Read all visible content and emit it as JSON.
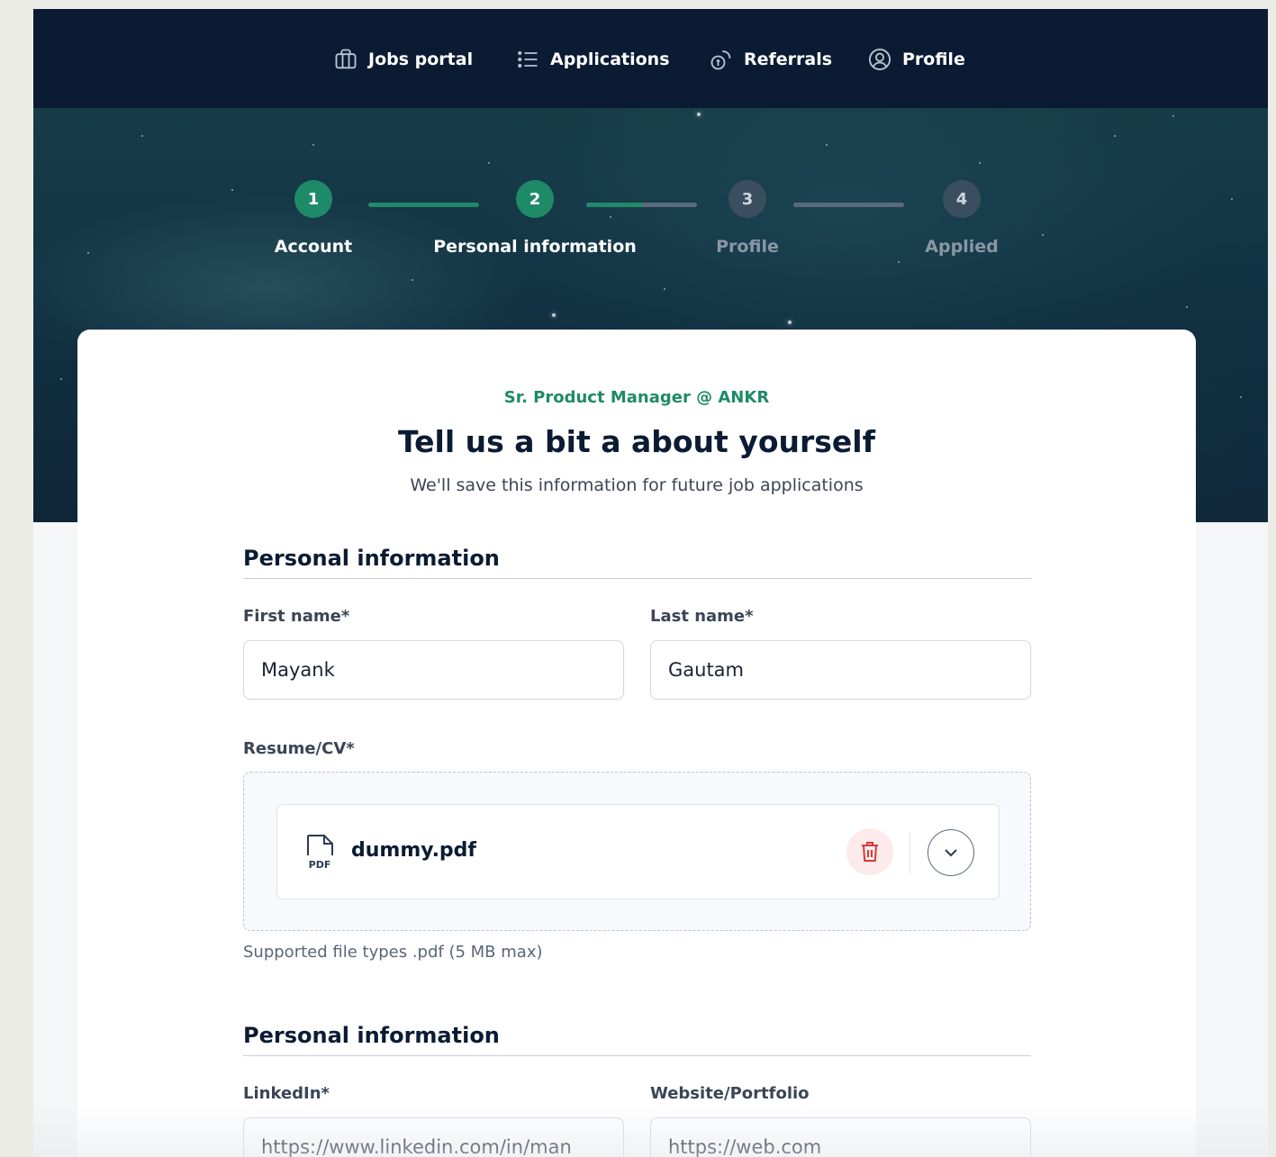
{
  "nav": {
    "items": [
      {
        "label": "Jobs portal",
        "icon": "briefcase-icon"
      },
      {
        "label": "Applications",
        "icon": "list-icon"
      },
      {
        "label": "Referrals",
        "icon": "coins-icon"
      },
      {
        "label": "Profile",
        "icon": "user-circle-icon"
      }
    ]
  },
  "stepper": {
    "steps": [
      {
        "number": "1",
        "label": "Account",
        "state": "done"
      },
      {
        "number": "2",
        "label": "Personal information",
        "state": "current"
      },
      {
        "number": "3",
        "label": "Profile",
        "state": "todo"
      },
      {
        "number": "4",
        "label": "Applied",
        "state": "todo"
      }
    ],
    "connector_progress": [
      1.0,
      0.5,
      0.0
    ]
  },
  "card": {
    "job_title": "Sr. Product Manager @ ANKR",
    "title": "Tell us a bit a about yourself",
    "subtitle": "We'll save this information for future job applications"
  },
  "section1": {
    "title": "Personal information",
    "first_name": {
      "label": "First name*",
      "value": "Mayank"
    },
    "last_name": {
      "label": "Last name*",
      "value": "Gautam"
    },
    "resume": {
      "label": "Resume/CV*",
      "file_name": "dummy.pdf",
      "file_type_badge": "PDF",
      "hint": "Supported file types .pdf (5 MB max)"
    }
  },
  "section2": {
    "title": "Personal information",
    "linkedin": {
      "label": "LinkedIn*",
      "value": "https://www.linkedin.com/in/man"
    },
    "website": {
      "label": "Website/Portfolio",
      "value": "https://web.com"
    }
  },
  "colors": {
    "navy": "#0b1b33",
    "accent_green": "#1f8a68",
    "danger": "#d93a3a"
  }
}
